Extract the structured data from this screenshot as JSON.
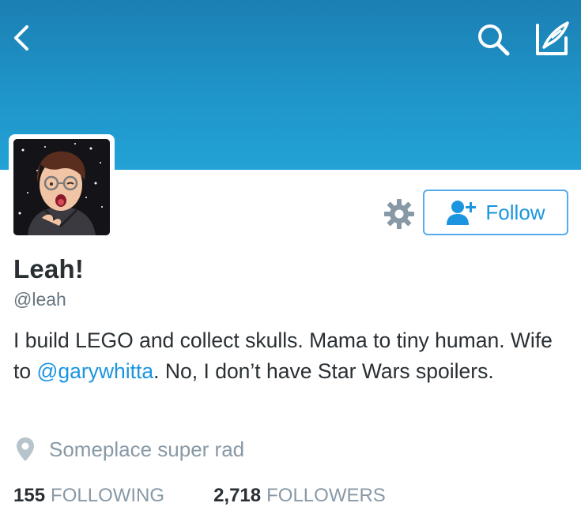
{
  "header": {
    "back_icon": "chevron-left-icon",
    "search_icon": "search-icon",
    "compose_icon": "compose-tweet-icon",
    "banner_color": "#1f95c9"
  },
  "profile": {
    "display_name": "Leah!",
    "handle": "@leah",
    "bio": {
      "part1": "I build LEGO and collect skulls. Mama to tiny human. Wife to ",
      "mention": "@garywhitta",
      "part2": ". No, I don’t have Star Wars spoilers."
    },
    "location": "Someplace super rad"
  },
  "actions": {
    "settings_icon": "gear-icon",
    "follow_label": "Follow",
    "follow_icon": "add-user-icon",
    "accent_color": "#1b95e0"
  },
  "stats": {
    "following_count": "155",
    "following_label": "FOLLOWING",
    "followers_count": "2,718",
    "followers_label": "FOLLOWERS"
  }
}
